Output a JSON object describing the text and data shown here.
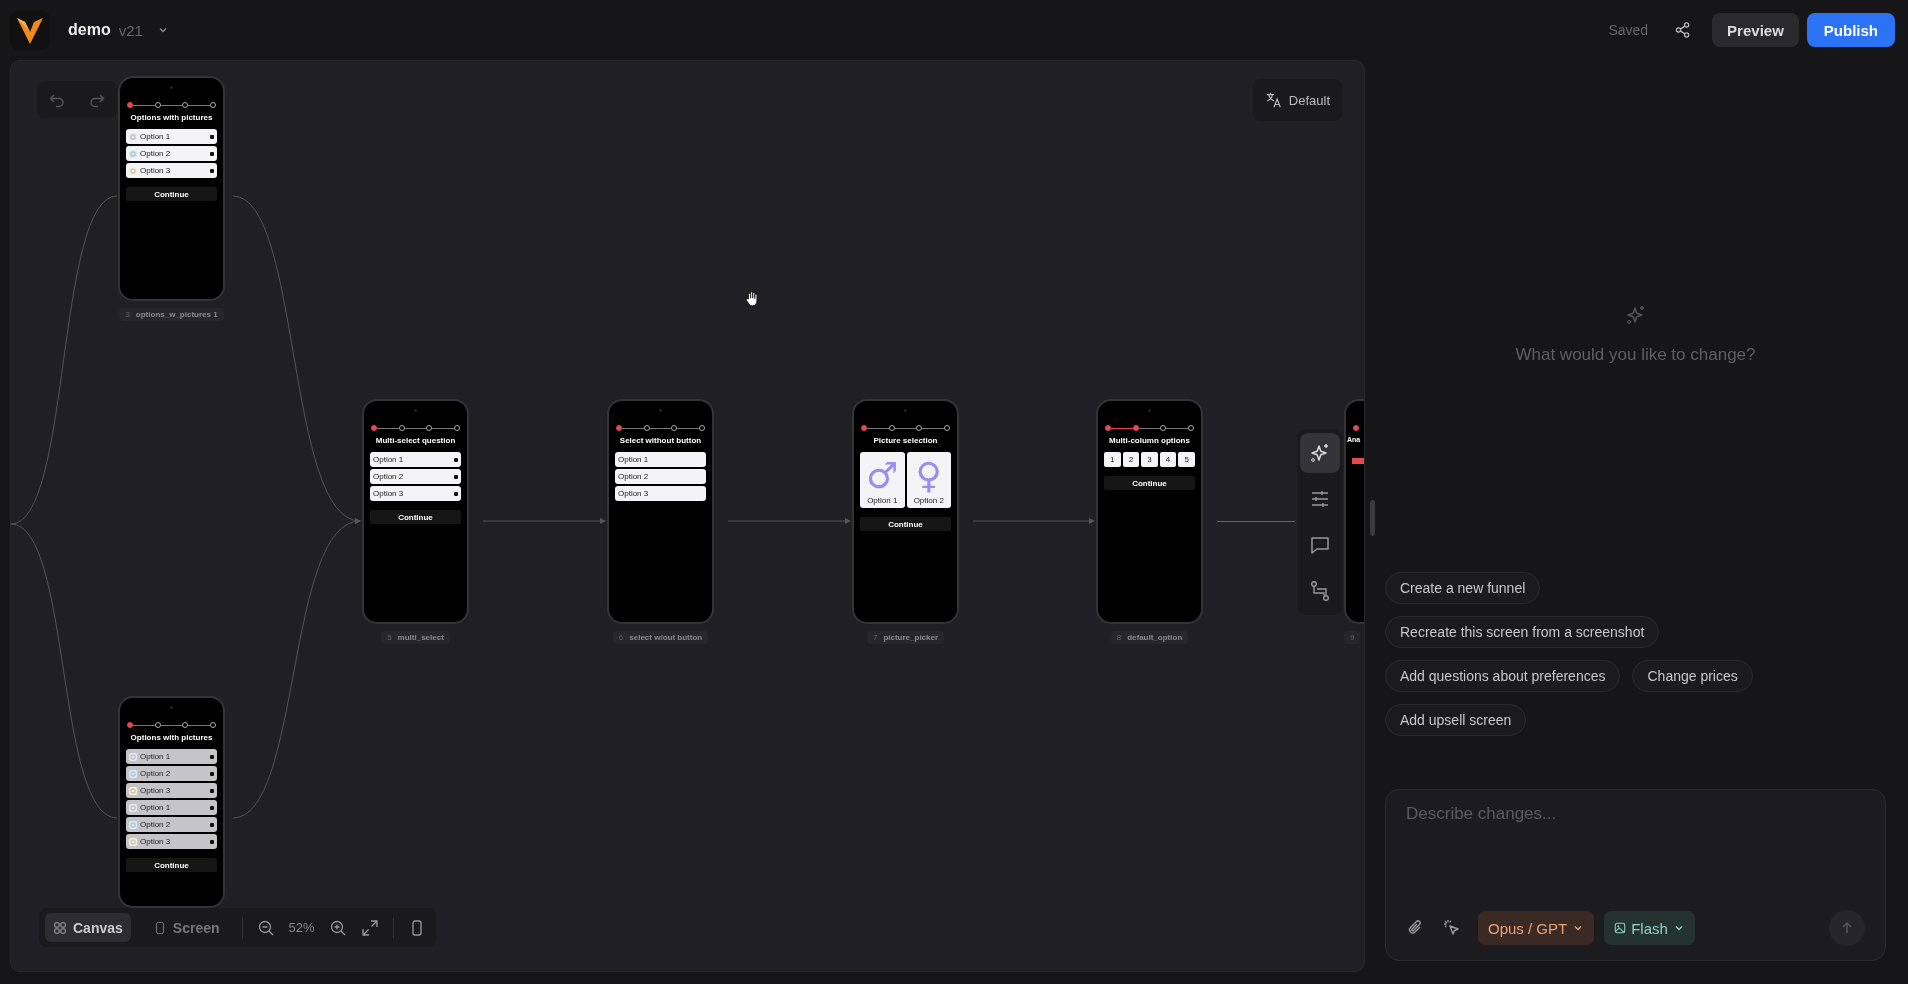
{
  "app": {
    "name": "demo",
    "version": "v21"
  },
  "header": {
    "status": "Saved",
    "buttons": [
      {
        "label": "Preview",
        "kind": "secondary"
      },
      {
        "label": "Publish",
        "kind": "primary"
      }
    ]
  },
  "canvas": {
    "language": {
      "label": "Default"
    },
    "screens": [
      {
        "number": "3",
        "label": "options_w_pictures 1",
        "kind": "options",
        "dimmed": false,
        "title": "Options with pictures",
        "steps": [
          {
            "done": true
          },
          {
            "done": false
          },
          {
            "done": false
          },
          {
            "done": false
          }
        ],
        "options": [
          {
            "label": "Option 1",
            "kind": "icon-check"
          },
          {
            "label": "Option 2",
            "kind": "icon-check"
          },
          {
            "label": "Option 3",
            "kind": "icon-check"
          }
        ],
        "button": "Continue"
      },
      {
        "number": "5",
        "label": "multi_select",
        "kind": "options",
        "dimmed": false,
        "title": "Multi-select question",
        "steps": [
          {
            "done": true
          },
          {
            "done": false
          },
          {
            "done": false
          },
          {
            "done": false
          }
        ],
        "options": [
          {
            "label": "Option 1",
            "kind": "check"
          },
          {
            "label": "Option 2",
            "kind": "check"
          },
          {
            "label": "Option 3",
            "kind": "check"
          }
        ],
        "button": "Continue"
      },
      {
        "number": "6",
        "label": "select w/out button",
        "kind": "options",
        "dimmed": false,
        "title": "Select without button",
        "steps": [
          {
            "done": true
          },
          {
            "done": false
          },
          {
            "done": false
          },
          {
            "done": false
          }
        ],
        "options": [
          {
            "label": "Option 1",
            "kind": "plain"
          },
          {
            "label": "Option 2",
            "kind": "plain"
          },
          {
            "label": "Option 3",
            "kind": "plain"
          }
        ]
      },
      {
        "number": "7",
        "label": "picture_picker",
        "kind": "cards",
        "title": "Picture selection",
        "steps": [
          {
            "done": true
          },
          {
            "done": false
          },
          {
            "done": false
          },
          {
            "done": false
          }
        ],
        "cards": [
          {
            "symbol": "♂",
            "label": "Option 1"
          },
          {
            "symbol": "♀",
            "label": "Option 2"
          }
        ],
        "button": "Continue"
      },
      {
        "number": "8",
        "label": "default_option",
        "kind": "columns",
        "title": "Multi-column options",
        "steps": [
          {
            "done": true
          },
          {
            "done": true
          },
          {
            "done": false
          },
          {
            "done": false
          }
        ],
        "columns": [
          "1",
          "2",
          "3",
          "4",
          "5"
        ],
        "button": "Continue"
      },
      {
        "number": "9",
        "kind": "bar",
        "title": "Ana",
        "steps": [
          {
            "done": true
          }
        ]
      },
      {
        "kind": "options",
        "dimmed": true,
        "title": "Options with pictures",
        "steps": [
          {
            "done": true
          },
          {
            "done": false
          },
          {
            "done": false
          },
          {
            "done": false
          }
        ],
        "options": [
          {
            "label": "Option 1",
            "kind": "icon-check"
          },
          {
            "label": "Option 2",
            "kind": "icon-check"
          },
          {
            "label": "Option 3",
            "kind": "icon-check"
          },
          {
            "label": "Option 1",
            "kind": "icon-check"
          },
          {
            "label": "Option 2",
            "kind": "icon-check"
          },
          {
            "label": "Option 3",
            "kind": "icon-check"
          }
        ],
        "button": "Continue"
      }
    ],
    "side_tools": [
      {
        "kind": "ai",
        "selected": true
      },
      {
        "kind": "settings",
        "selected": false
      },
      {
        "kind": "comments",
        "selected": false
      },
      {
        "kind": "flow",
        "selected": false
      }
    ],
    "view_modes": [
      {
        "label": "Canvas",
        "kind": "canvas",
        "selected": true
      },
      {
        "label": "Screen",
        "kind": "screen",
        "selected": false
      }
    ],
    "zoom": "52%"
  },
  "assistant": {
    "prompt": "What would you like to change?",
    "suggestions": [
      [
        "Create a new funnel"
      ],
      [
        "Recreate this screen from a screenshot"
      ],
      [
        "Add questions about preferences",
        "Change prices"
      ],
      [
        "Add upsell screen"
      ]
    ],
    "input": {
      "placeholder": "Describe changes..."
    },
    "model": "Opus / GPT",
    "image_model": "Flash"
  }
}
